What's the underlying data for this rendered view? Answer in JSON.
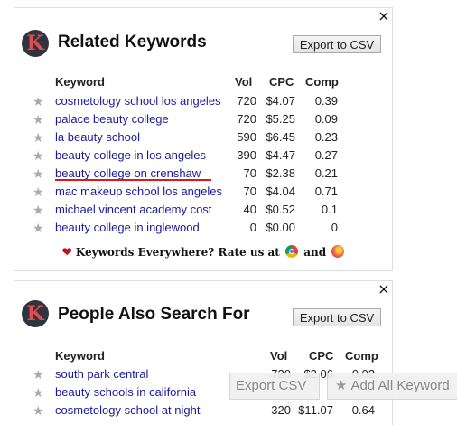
{
  "related": {
    "logo_letter": "K",
    "title": "Related Keywords",
    "export_label": "Export to CSV",
    "close_glyph": "×",
    "columns": {
      "keyword": "Keyword",
      "vol": "Vol",
      "cpc": "CPC",
      "comp": "Comp"
    },
    "rows": [
      {
        "keyword": "cosmetology school los angeles",
        "vol": "720",
        "cpc": "$4.07",
        "comp": "0.39"
      },
      {
        "keyword": "palace beauty college",
        "vol": "720",
        "cpc": "$5.25",
        "comp": "0.09"
      },
      {
        "keyword": "la beauty school",
        "vol": "590",
        "cpc": "$6.45",
        "comp": "0.23"
      },
      {
        "keyword": "beauty college in los angeles",
        "vol": "390",
        "cpc": "$4.47",
        "comp": "0.27"
      },
      {
        "keyword": "beauty college on crenshaw",
        "vol": "70",
        "cpc": "$2.38",
        "comp": "0.21"
      },
      {
        "keyword": "mac makeup school los angeles",
        "vol": "70",
        "cpc": "$4.04",
        "comp": "0.71"
      },
      {
        "keyword": "michael vincent academy cost",
        "vol": "40",
        "cpc": "$0.52",
        "comp": "0.1"
      },
      {
        "keyword": "beauty college in inglewood",
        "vol": "0",
        "cpc": "$0.00",
        "comp": "0"
      }
    ],
    "rate_text": "Keywords Everywhere? Rate us at",
    "rate_and": "and"
  },
  "people": {
    "logo_letter": "K",
    "title": "People Also Search For",
    "export_label": "Export to CSV",
    "close_glyph": "×",
    "columns": {
      "keyword": "Keyword",
      "vol": "Vol",
      "cpc": "CPC",
      "comp": "Comp"
    },
    "rows": [
      {
        "keyword": "south park central",
        "vol": "720",
        "cpc": "$2.06",
        "comp": "0.02"
      },
      {
        "keyword": "beauty schools in california",
        "vol": "",
        "cpc": "",
        "comp": ""
      },
      {
        "keyword": "cosmetology school at night",
        "vol": "320",
        "cpc": "$11.07",
        "comp": "0.64"
      }
    ]
  },
  "overlay": {
    "export_label": "Export CSV",
    "add_all_label": "Add All Keyword"
  },
  "colors": {
    "link": "#1a1a9c",
    "highlight": "#e0181b",
    "logo_bg": "#2e3540",
    "logo_fg": "#e24b4b"
  }
}
